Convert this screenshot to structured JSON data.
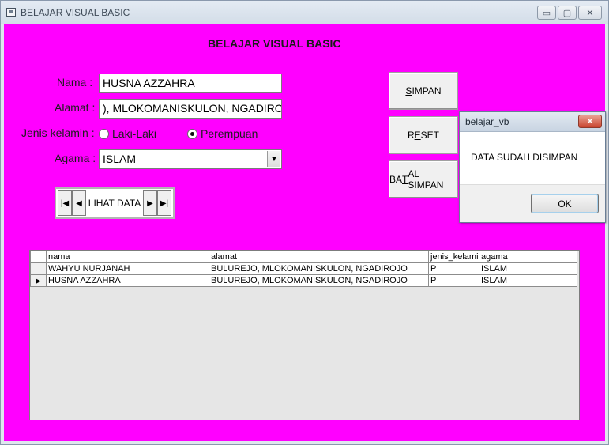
{
  "window": {
    "title": "BELAJAR VISUAL BASIC",
    "controls": {
      "minimize": "▭",
      "maximize": "▢",
      "close": "✕"
    }
  },
  "form": {
    "heading": "BELAJAR VISUAL BASIC",
    "nama_label": "Nama :",
    "nama_value": "HUSNA AZZAHRA",
    "alamat_label": "Alamat :",
    "alamat_value": "), MLOKOMANISKULON, NGADIROJO",
    "jenis_label": "Jenis kelamin :",
    "radio_laki": "Laki-Laki",
    "radio_perempuan": "Perempuan",
    "agama_label": "Agama :",
    "agama_value": "ISLAM"
  },
  "data_nav": {
    "caption": "LIHAT DATA",
    "first": "|◀",
    "prev": "◀",
    "next": "▶",
    "last": "▶|"
  },
  "buttons": {
    "simpan_key": "S",
    "simpan_rest": "IMPAN",
    "reset_pre": "R",
    "reset_key": "E",
    "reset_rest": "SET",
    "batal_pre": "BA",
    "batal_key": "T",
    "batal_rest": "AL SIMPAN"
  },
  "grid": {
    "columns": [
      "nama",
      "alamat",
      "jenis_kelamin",
      "agama"
    ],
    "rows": [
      {
        "indicator": "",
        "cells": [
          "WAHYU NURJANAH",
          "BULUREJO, MLOKOMANISKULON, NGADIROJO",
          "P",
          "ISLAM"
        ]
      },
      {
        "indicator": "▶",
        "cells": [
          "HUSNA AZZAHRA",
          "BULUREJO, MLOKOMANISKULON, NGADIROJO",
          "P",
          "ISLAM"
        ]
      }
    ]
  },
  "dialog": {
    "title": "belajar_vb",
    "close": "✕",
    "message": "DATA SUDAH DISIMPAN",
    "ok": "OK"
  }
}
